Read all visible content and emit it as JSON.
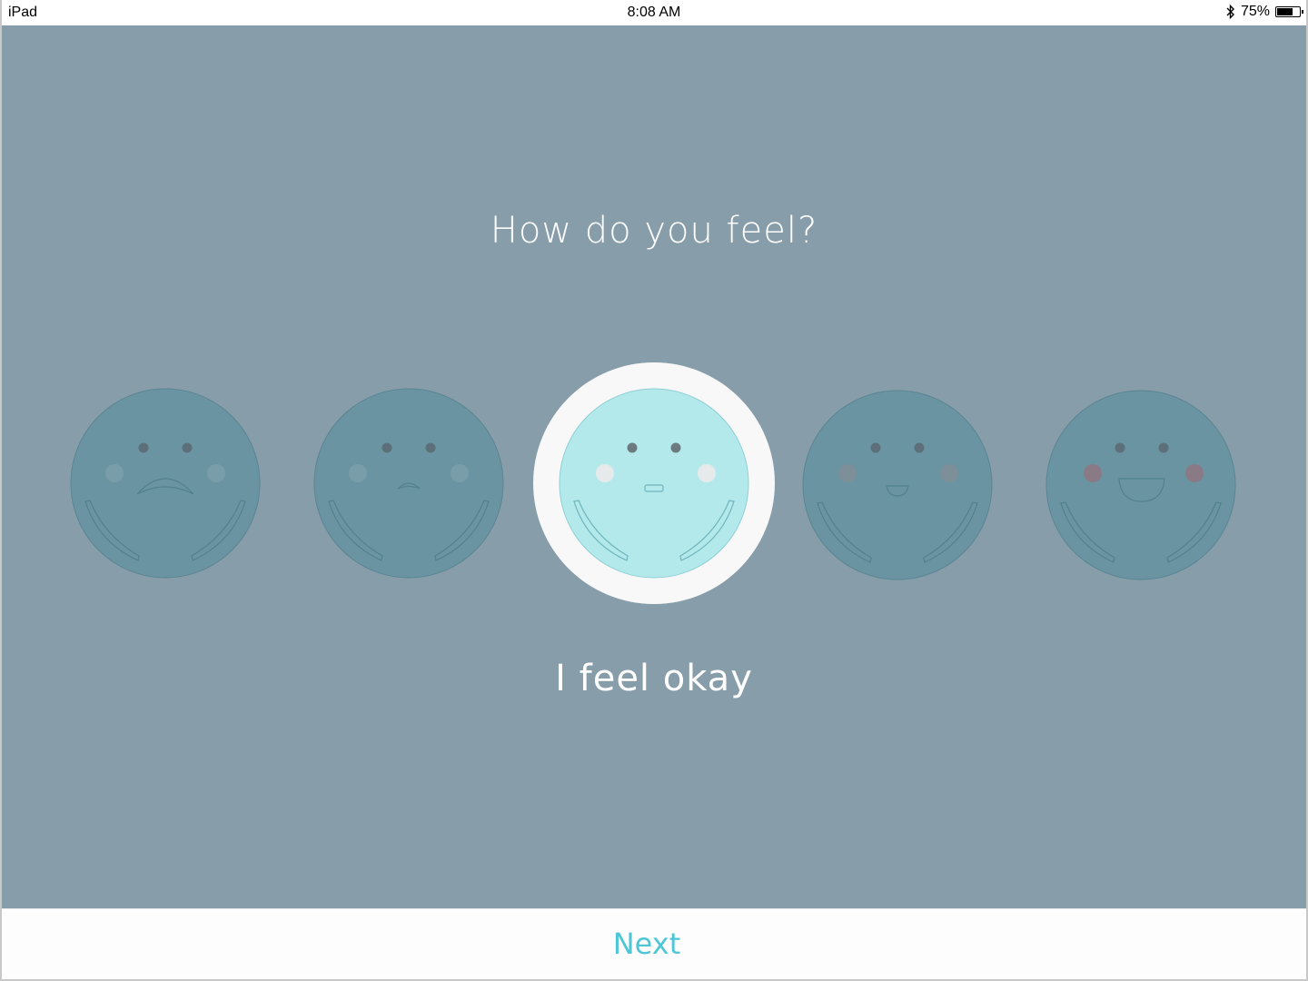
{
  "status_bar": {
    "device": "iPad",
    "time": "8:08 AM",
    "battery": "75%",
    "battery_level": 0.75,
    "bluetooth_icon": "bluetooth-icon",
    "battery_icon": "battery-icon"
  },
  "screen": {
    "question": "How do you feel?",
    "selected_label": "I feel okay",
    "selected_index": 2,
    "faces": [
      {
        "mood": "very-sad",
        "icon": "very-sad-face-icon"
      },
      {
        "mood": "sad",
        "icon": "sad-face-icon"
      },
      {
        "mood": "okay",
        "icon": "neutral-face-icon"
      },
      {
        "mood": "happy",
        "icon": "smile-face-icon"
      },
      {
        "mood": "very-happy",
        "icon": "big-smile-face-icon"
      }
    ]
  },
  "footer": {
    "next_label": "Next"
  },
  "colors": {
    "background": "#879daa",
    "face": "#6a94a1",
    "face_selected": "#b3e9eb",
    "accent": "#4ec6d6",
    "selection_ring": "#ffffff"
  }
}
